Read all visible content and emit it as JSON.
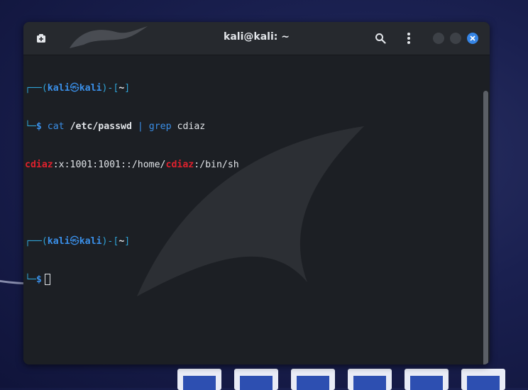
{
  "window": {
    "title": "kali@kali: ~"
  },
  "titlebar": {
    "new_tab_icon": "new-tab-icon",
    "search_icon": "search-icon",
    "menu_icon": "kebab-menu-icon",
    "close_icon": "close-icon"
  },
  "colors": {
    "accent": "#3584e4",
    "prompt_blue": "#3a8fe8",
    "match_red": "#e0212d",
    "terminal_bg": "#1c1f24"
  },
  "terminal": {
    "prompt1": {
      "open": "┌──(",
      "user": "kali",
      "at": "㉿",
      "host": "kali",
      "mid": ")-[",
      "dir": "~",
      "close": "]"
    },
    "cmd1": {
      "tail": "└─",
      "dollar": "$",
      "cmd": "cat",
      "arg": "/etc/passwd",
      "pipe": "|",
      "cmd2": "grep",
      "arg2": "cdiaz"
    },
    "output1": {
      "match1": "cdiaz",
      "part1": ":x:1001:1001::/home/",
      "match2": "cdiaz",
      "part2": ":/bin/sh"
    },
    "prompt2": {
      "open": "┌──(",
      "user": "kali",
      "at": "㉿",
      "host": "kali",
      "mid": ")-[",
      "dir": "~",
      "close": "]"
    },
    "cmd2": {
      "tail": "└─",
      "dollar": "$"
    }
  }
}
